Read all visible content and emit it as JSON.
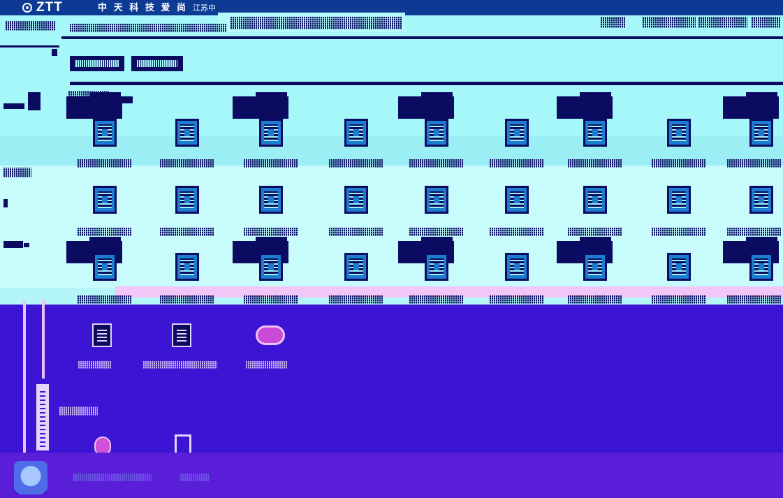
{
  "header": {
    "logo_text": "ZTT",
    "brand": "中 天 科 技 爱 尚",
    "user_text": "江苏中"
  },
  "colors": {
    "header_bg": "#0d3b94",
    "main_bg": "#a6f7fa",
    "accent_navy": "#0b0b62",
    "lower_bg": "#3b14d4",
    "bottom_bg": "#5a1ed8",
    "pink": "#f0c0f8"
  },
  "icons": {
    "logo": "ztt-logo-icon",
    "app": "app-icon",
    "avatar": "user-avatar"
  }
}
